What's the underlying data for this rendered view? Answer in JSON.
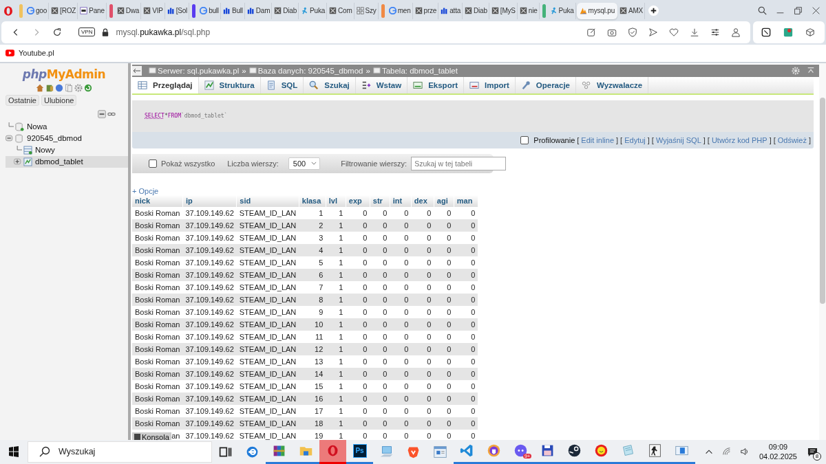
{
  "browser": {
    "tabs": [
      {
        "kind": "group",
        "color": "#f0c25e"
      },
      {
        "kind": "tab",
        "title": "goo",
        "selected": false
      },
      {
        "kind": "tab",
        "title": "[ROZ",
        "selected": false
      },
      {
        "kind": "tab",
        "title": "Pane",
        "selected": false
      },
      {
        "kind": "group",
        "color": "#e0506a"
      },
      {
        "kind": "tab",
        "title": "Dwa",
        "selected": false
      },
      {
        "kind": "tab",
        "title": "VIP",
        "selected": false
      },
      {
        "kind": "tab",
        "title": "[Sol",
        "selected": false
      },
      {
        "kind": "group",
        "color": "#5a3cf0"
      },
      {
        "kind": "tab",
        "title": "bull",
        "selected": false
      },
      {
        "kind": "tab",
        "title": "Bull",
        "selected": false
      },
      {
        "kind": "tab",
        "title": "Dam",
        "selected": false
      },
      {
        "kind": "tab",
        "title": "Diab",
        "selected": false
      },
      {
        "kind": "tab",
        "title": "Puka",
        "selected": false
      },
      {
        "kind": "tab",
        "title": "Com",
        "selected": false
      },
      {
        "kind": "tab",
        "title": "Szy",
        "selected": false
      },
      {
        "kind": "group",
        "color": "#f08a45"
      },
      {
        "kind": "tab",
        "title": "men",
        "selected": false
      },
      {
        "kind": "tab",
        "title": "prze",
        "selected": false
      },
      {
        "kind": "tab",
        "title": "atta",
        "selected": false
      },
      {
        "kind": "tab",
        "title": "Diab",
        "selected": false
      },
      {
        "kind": "tab",
        "title": "[MyS",
        "selected": false
      },
      {
        "kind": "tab",
        "title": "nie",
        "selected": false
      },
      {
        "kind": "group",
        "color": "#45b27a"
      },
      {
        "kind": "tab",
        "title": "Puka",
        "selected": false
      },
      {
        "kind": "tab",
        "title": "mysql.pu",
        "selected": true
      },
      {
        "kind": "tab",
        "title": "AMX",
        "selected": false
      }
    ],
    "vpn": "VPN",
    "url": {
      "host_start": "mysql.",
      "domain": "pukawka.pl",
      "path": "/sql.php"
    },
    "bookmarks": [
      "Youtube.pl"
    ]
  },
  "sidebar": {
    "logo": {
      "prefix": "php",
      "name": "MyAdmin"
    },
    "buttons": [
      "Ostatnie",
      "Ulubione"
    ],
    "tree": [
      {
        "label": "Nowa",
        "expanded": false,
        "selected": false
      },
      {
        "label": "920545_dbmod",
        "expanded": true,
        "selected": false,
        "children": [
          {
            "label": "Nowy",
            "expanded": false,
            "selected": false
          },
          {
            "label": "dbmod_tablet",
            "expanded": false,
            "selected": true
          }
        ]
      }
    ]
  },
  "breadcrumb": {
    "separator": "»",
    "items": [
      "Serwer: sql.pukawka.pl",
      "Baza danych: 920545_dbmod",
      "Tabela: dbmod_tablet"
    ]
  },
  "tabs": [
    {
      "label": "Przeglądaj",
      "selected": true
    },
    {
      "label": "Struktura",
      "selected": false
    },
    {
      "label": "SQL",
      "selected": false
    },
    {
      "label": "Szukaj",
      "selected": false
    },
    {
      "label": "Wstaw",
      "selected": false
    },
    {
      "label": "Eksport",
      "selected": false
    },
    {
      "label": "Import",
      "selected": false
    },
    {
      "label": "Operacje",
      "selected": false
    },
    {
      "label": "Wyzwalacze",
      "selected": false
    }
  ],
  "query": [
    {
      "kind": "keyword",
      "text": "SELECT"
    },
    {
      "kind": "operator",
      "text": "*"
    },
    {
      "kind": "keyword",
      "text": "FROM"
    },
    {
      "kind": "identifier",
      "text": "`dbmod_tablet`"
    }
  ],
  "profiling": {
    "label": "Profilowanie",
    "checked": false,
    "open": "[",
    "close": "]",
    "links": [
      "Edit inline",
      "Edytuj",
      "Wyjaśnij SQL",
      "Utwórz kod PHP",
      "Odśwież"
    ]
  },
  "options_bar": {
    "show_all": {
      "label": "Pokaż wszystko",
      "checked": false
    },
    "rows_label": "Liczba wierszy:",
    "rows_value": "500",
    "filter_label": "Filtrowanie wierszy:",
    "filter_placeholder": "Szukaj w tej tabeli"
  },
  "options_link": "+ Opcje",
  "table": {
    "columns": [
      {
        "label": "nick",
        "kind": "text"
      },
      {
        "label": "ip",
        "kind": "text"
      },
      {
        "label": "sid",
        "kind": "text"
      },
      {
        "label": "klasa",
        "kind": "number"
      },
      {
        "label": "lvl",
        "kind": "number"
      },
      {
        "label": "exp",
        "kind": "number"
      },
      {
        "label": "str",
        "kind": "number"
      },
      {
        "label": "int",
        "kind": "number"
      },
      {
        "label": "dex",
        "kind": "number"
      },
      {
        "label": "agi",
        "kind": "number"
      },
      {
        "label": "man",
        "kind": "number"
      }
    ],
    "rows": [
      [
        "Boski Roman",
        "37.109.149.62",
        "STEAM_ID_LAN",
        "1",
        "1",
        "0",
        "0",
        "0",
        "0",
        "0",
        "0"
      ],
      [
        "Boski Roman",
        "37.109.149.62",
        "STEAM_ID_LAN",
        "2",
        "1",
        "0",
        "0",
        "0",
        "0",
        "0",
        "0"
      ],
      [
        "Boski Roman",
        "37.109.149.62",
        "STEAM_ID_LAN",
        "3",
        "1",
        "0",
        "0",
        "0",
        "0",
        "0",
        "0"
      ],
      [
        "Boski Roman",
        "37.109.149.62",
        "STEAM_ID_LAN",
        "4",
        "1",
        "0",
        "0",
        "0",
        "0",
        "0",
        "0"
      ],
      [
        "Boski Roman",
        "37.109.149.62",
        "STEAM_ID_LAN",
        "5",
        "1",
        "0",
        "0",
        "0",
        "0",
        "0",
        "0"
      ],
      [
        "Boski Roman",
        "37.109.149.62",
        "STEAM_ID_LAN",
        "6",
        "1",
        "0",
        "0",
        "0",
        "0",
        "0",
        "0"
      ],
      [
        "Boski Roman",
        "37.109.149.62",
        "STEAM_ID_LAN",
        "7",
        "1",
        "0",
        "0",
        "0",
        "0",
        "0",
        "0"
      ],
      [
        "Boski Roman",
        "37.109.149.62",
        "STEAM_ID_LAN",
        "8",
        "1",
        "0",
        "0",
        "0",
        "0",
        "0",
        "0"
      ],
      [
        "Boski Roman",
        "37.109.149.62",
        "STEAM_ID_LAN",
        "9",
        "1",
        "0",
        "0",
        "0",
        "0",
        "0",
        "0"
      ],
      [
        "Boski Roman",
        "37.109.149.62",
        "STEAM_ID_LAN",
        "10",
        "1",
        "0",
        "0",
        "0",
        "0",
        "0",
        "0"
      ],
      [
        "Boski Roman",
        "37.109.149.62",
        "STEAM_ID_LAN",
        "11",
        "1",
        "0",
        "0",
        "0",
        "0",
        "0",
        "0"
      ],
      [
        "Boski Roman",
        "37.109.149.62",
        "STEAM_ID_LAN",
        "12",
        "1",
        "0",
        "0",
        "0",
        "0",
        "0",
        "0"
      ],
      [
        "Boski Roman",
        "37.109.149.62",
        "STEAM_ID_LAN",
        "13",
        "1",
        "0",
        "0",
        "0",
        "0",
        "0",
        "0"
      ],
      [
        "Boski Roman",
        "37.109.149.62",
        "STEAM_ID_LAN",
        "14",
        "1",
        "0",
        "0",
        "0",
        "0",
        "0",
        "0"
      ],
      [
        "Boski Roman",
        "37.109.149.62",
        "STEAM_ID_LAN",
        "15",
        "1",
        "0",
        "0",
        "0",
        "0",
        "0",
        "0"
      ],
      [
        "Boski Roman",
        "37.109.149.62",
        "STEAM_ID_LAN",
        "16",
        "1",
        "0",
        "0",
        "0",
        "0",
        "0",
        "0"
      ],
      [
        "Boski Roman",
        "37.109.149.62",
        "STEAM_ID_LAN",
        "17",
        "1",
        "0",
        "0",
        "0",
        "0",
        "0",
        "0"
      ],
      [
        "Boski Roman",
        "37.109.149.62",
        "STEAM_ID_LAN",
        "18",
        "1",
        "0",
        "0",
        "0",
        "0",
        "0",
        "0"
      ],
      [
        "an",
        "37.109.149.62",
        "STEAM_ID_LAN",
        "19",
        "1",
        "0",
        "0",
        "0",
        "0",
        "0",
        "0"
      ]
    ]
  },
  "console": "Konsola",
  "taskbar": {
    "search_placeholder": "Wyszukaj",
    "apps": [
      {
        "running": false,
        "selected": false
      },
      {
        "running": false,
        "selected": false
      },
      {
        "running": true,
        "selected": false
      },
      {
        "running": true,
        "selected": false
      },
      {
        "running": true,
        "selected": true
      },
      {
        "running": true,
        "selected": false,
        "label": "Ps"
      },
      {
        "running": false,
        "selected": false
      },
      {
        "running": false,
        "selected": false
      },
      {
        "running": false,
        "selected": false
      },
      {
        "running": true,
        "selected": false
      },
      {
        "running": true,
        "selected": false
      },
      {
        "running": true,
        "selected": false,
        "badge": "9+"
      },
      {
        "running": true,
        "selected": false
      },
      {
        "running": true,
        "selected": false
      },
      {
        "running": true,
        "selected": false
      },
      {
        "running": true,
        "selected": false
      },
      {
        "running": true,
        "selected": false
      },
      {
        "running": true,
        "selected": false
      }
    ],
    "time": "09:09",
    "date": "04.02.2025",
    "notifications": "8"
  }
}
